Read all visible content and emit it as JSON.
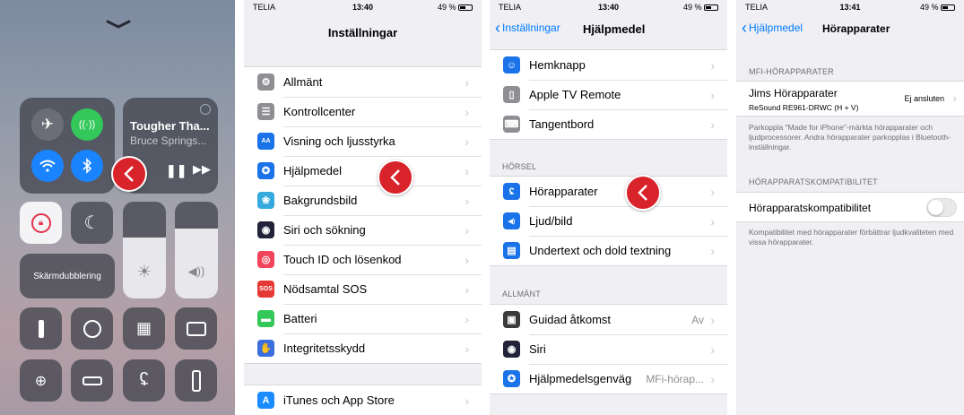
{
  "control_center": {
    "now_playing_title": "Tougher Tha...",
    "now_playing_artist": "Bruce Springs...",
    "screen_mirroring_label": "Skärmdubblering"
  },
  "settings": {
    "status": {
      "carrier": "TELIA",
      "time": "13:40",
      "battery": "49 %"
    },
    "title": "Inställningar",
    "items": [
      {
        "label": "Allmänt",
        "icon": "gear-icon",
        "color": "#8e8e93"
      },
      {
        "label": "Kontrollcenter",
        "icon": "toggles-icon",
        "color": "#8e8e93"
      },
      {
        "label": "Visning och ljusstyrka",
        "icon": "text-size-icon",
        "color": "#1a73e8"
      },
      {
        "label": "Hjälpmedel",
        "icon": "accessibility-icon",
        "color": "#1a73e8"
      },
      {
        "label": "Bakgrundsbild",
        "icon": "flower-icon",
        "color": "#36aadc"
      },
      {
        "label": "Siri och sökning",
        "icon": "siri-icon",
        "color": "#222238"
      },
      {
        "label": "Touch ID och lösenkod",
        "icon": "fingerprint-icon",
        "color": "#f0455a"
      },
      {
        "label": "Nödsamtal SOS",
        "icon": "sos-icon",
        "color": "#e53935"
      },
      {
        "label": "Batteri",
        "icon": "battery-icon",
        "color": "#34c759"
      },
      {
        "label": "Integritetsskydd",
        "icon": "hand-icon",
        "color": "#3b6fe0"
      }
    ],
    "items2": [
      {
        "label": "iTunes och App Store",
        "icon": "app-store-icon",
        "color": "#1a8cff"
      }
    ]
  },
  "accessibility": {
    "status": {
      "carrier": "TELIA",
      "time": "13:40",
      "battery": "49 %"
    },
    "back": "Inställningar",
    "title": "Hjälpmedel",
    "items_top": [
      {
        "label": "Hemknapp",
        "icon": "home-button-icon",
        "color": "#1a73e8"
      },
      {
        "label": "Apple TV Remote",
        "icon": "remote-icon",
        "color": "#8e8e93"
      },
      {
        "label": "Tangentbord",
        "icon": "keyboard-icon",
        "color": "#8e8e93"
      }
    ],
    "hearing_header": "HÖRSEL",
    "items_hearing": [
      {
        "label": "Hörapparater",
        "icon": "ear-icon",
        "color": "#1a73e8"
      },
      {
        "label": "Ljud/bild",
        "icon": "speaker-icon",
        "color": "#1a73e8"
      },
      {
        "label": "Undertext och dold textning",
        "icon": "caption-icon",
        "color": "#1a73e8"
      }
    ],
    "general_header": "ALLMÄNT",
    "items_general": [
      {
        "label": "Guidad åtkomst",
        "icon": "lock-icon",
        "color": "#3a3a3c",
        "detail": "Av"
      },
      {
        "label": "Siri",
        "icon": "siri-icon",
        "color": "#222238",
        "detail": ""
      },
      {
        "label": "Hjälpmedelsgenväg",
        "icon": "accessibility-icon",
        "color": "#1a73e8",
        "detail": "MFi-hörap..."
      }
    ]
  },
  "hearing_devices": {
    "status": {
      "carrier": "TELIA",
      "time": "13:41",
      "battery": "49 %"
    },
    "back": "Hjälpmedel",
    "title": "Hörapparater",
    "mfi_header": "MFI-HÖRAPPARATER",
    "device_name": "Jims Hörapparater",
    "device_model": "ReSound RE961-DRWC (H + V)",
    "device_status": "Ej ansluten",
    "mfi_footnote": "Parkoppla \"Made for iPhone\"-märkta hörapparater och ljudprocessorer. Andra hörapparater parkopplas i Bluetooth-inställningar.",
    "compat_header": "HÖRAPPARATSKOMPATIBILITET",
    "compat_label": "Hörapparatskompatibilitet",
    "compat_footnote": "Kompatibilitet med hörapparater förbättrar ljudkvaliteten med vissa hörapparater."
  }
}
